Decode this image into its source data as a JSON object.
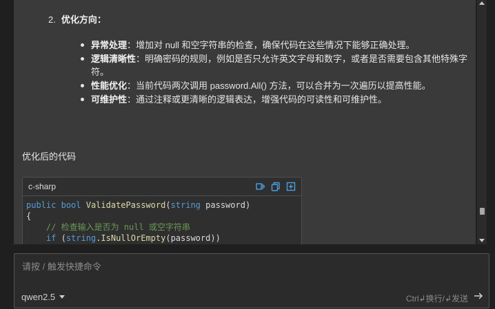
{
  "section2": {
    "number": "2.",
    "title": "优化方向："
  },
  "bullets": [
    {
      "bold": "异常处理",
      "text": "：增加对 null 和空字符串的检查，确保代码在这些情况下能够正确处理。"
    },
    {
      "bold": "逻辑清晰性",
      "text": "：明确密码的规则，例如是否只允许英文字母和数字，或者是否需要包含其他特殊字符。"
    },
    {
      "bold": "性能优化",
      "text": "：当前代码两次调用 password.All() 方法，可以合并为一次遍历以提高性能。"
    },
    {
      "bold": "可维护性",
      "text": "：通过注释或更清晰的逻辑表达，增强代码的可读性和可维护性。"
    }
  ],
  "optimized_title": "优化后的代码",
  "code": {
    "language": "c-sharp",
    "line1": {
      "kw1": "public",
      "kw2": "bool",
      "fn": "ValidatePassword",
      "kw3": "string",
      "param": "password"
    },
    "line2": "{",
    "line3_comment": "// 检查输入是否为 null 或空字符串",
    "line4": {
      "kw": "if",
      "type": "string",
      "method": "IsNullOrEmpty",
      "arg": "password"
    }
  },
  "input": {
    "placeholder": "请按 / 触发快捷命令",
    "model": "qwen2.5",
    "hint": "Ctrl↲换行/↲发送"
  },
  "icons": [
    "insert-code-icon",
    "copy-icon",
    "add-file-icon",
    "dropdown-caret-icon",
    "send-arrow-icon"
  ]
}
